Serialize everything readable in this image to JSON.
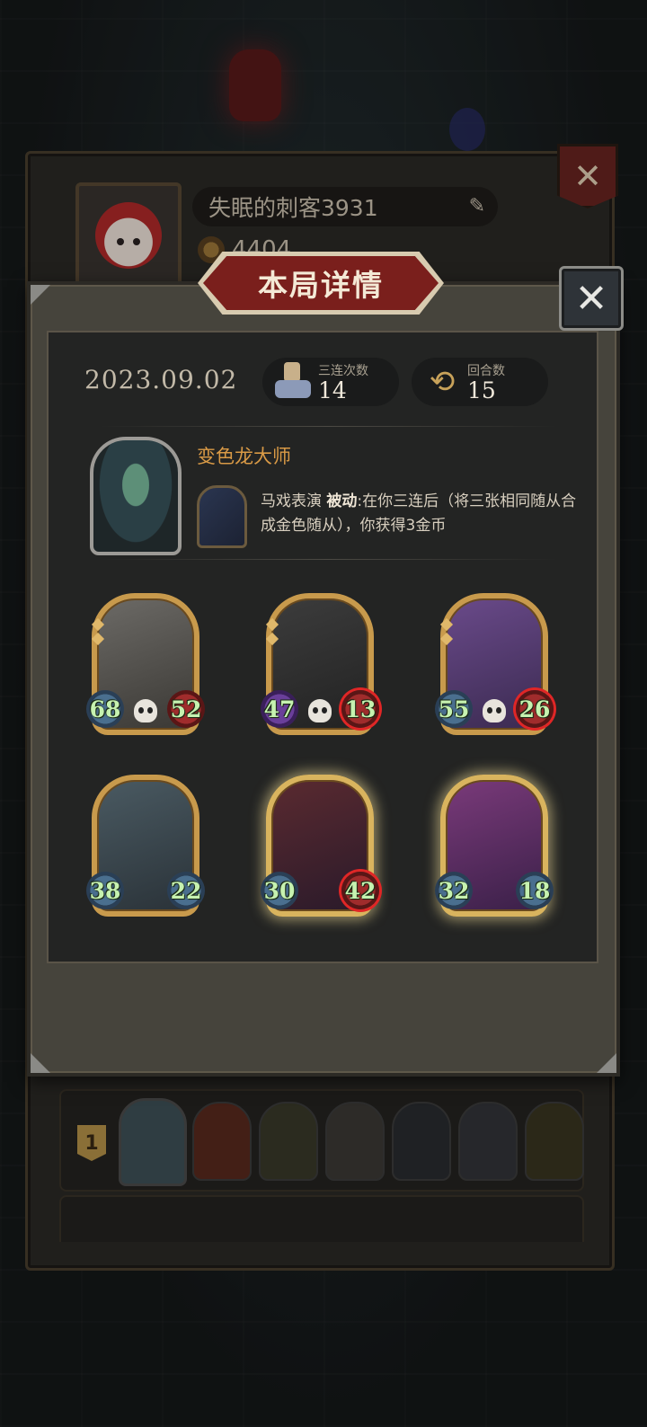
{
  "profile": {
    "player_name": "失眠的刺客3931",
    "score": "4404",
    "edit_icon": "pencil-icon",
    "close_icon": "close-icon"
  },
  "modal": {
    "title": "本局详情",
    "close_icon": "close-icon",
    "date": "2023.09.02",
    "stats": {
      "triples_label": "三连次数",
      "triples_value": "14",
      "rounds_label": "回合数",
      "rounds_value": "15"
    },
    "hero": {
      "name": "变色龙大师",
      "skill_name": "马戏表演",
      "skill_type": "被动",
      "skill_desc": ":在你三连后（将三张相同随从合成金色随从），你获得3金币"
    },
    "units": [
      {
        "attack": "68",
        "health": "52",
        "golden": false
      },
      {
        "attack": "47",
        "health": "13",
        "golden": false
      },
      {
        "attack": "55",
        "health": "26",
        "golden": false
      },
      {
        "attack": "38",
        "health": "22",
        "golden": false
      },
      {
        "attack": "30",
        "health": "42",
        "golden": true
      },
      {
        "attack": "32",
        "health": "18",
        "golden": true
      }
    ]
  },
  "ranking": {
    "rank1": "1"
  },
  "colors": {
    "accent_red": "#7a1f1c",
    "hero_name": "#d99a46",
    "stat_green": "#c6f2b0",
    "frame_gold": "#c89a4c"
  }
}
